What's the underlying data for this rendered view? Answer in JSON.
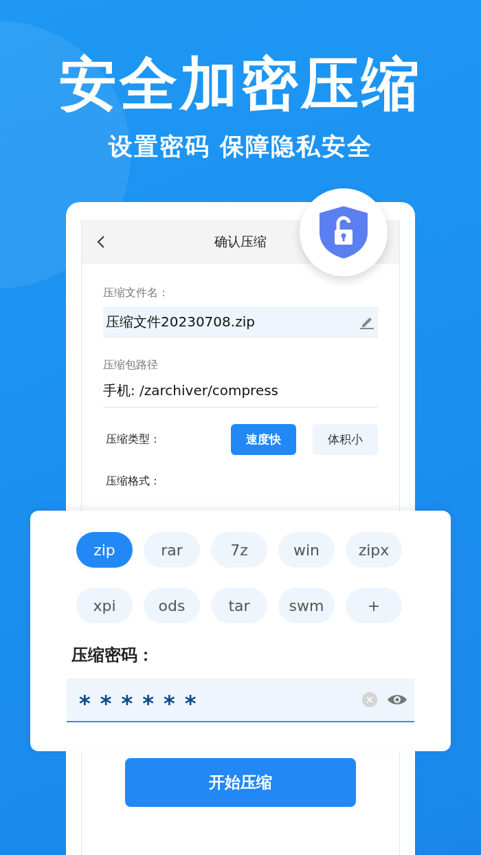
{
  "hero": {
    "title": "安全加密压缩",
    "subtitle": "设置密码 保障隐私安全"
  },
  "screen": {
    "title": "确认压缩",
    "file_name": {
      "label": "压缩文件名：",
      "value": "压缩文件20230708.zip"
    },
    "path": {
      "label": "压缩包路径",
      "value": "手机: /zarchiver/compress"
    },
    "compress_type": {
      "label": "压缩类型：",
      "options": [
        {
          "label": "速度快",
          "selected": true
        },
        {
          "label": "体积小",
          "selected": false
        }
      ]
    },
    "format_label": "压缩格式：",
    "start_button": "开始压缩"
  },
  "popup": {
    "formats": [
      {
        "label": "zip",
        "selected": true
      },
      {
        "label": "rar",
        "selected": false
      },
      {
        "label": "7z",
        "selected": false
      },
      {
        "label": "win",
        "selected": false
      },
      {
        "label": "zipx",
        "selected": false
      },
      {
        "label": "xpi",
        "selected": false
      },
      {
        "label": "ods",
        "selected": false
      },
      {
        "label": "tar",
        "selected": false
      },
      {
        "label": "swm",
        "selected": false
      },
      {
        "label": "+",
        "selected": false
      }
    ],
    "password": {
      "label": "压缩密码：",
      "value": "******"
    }
  }
}
